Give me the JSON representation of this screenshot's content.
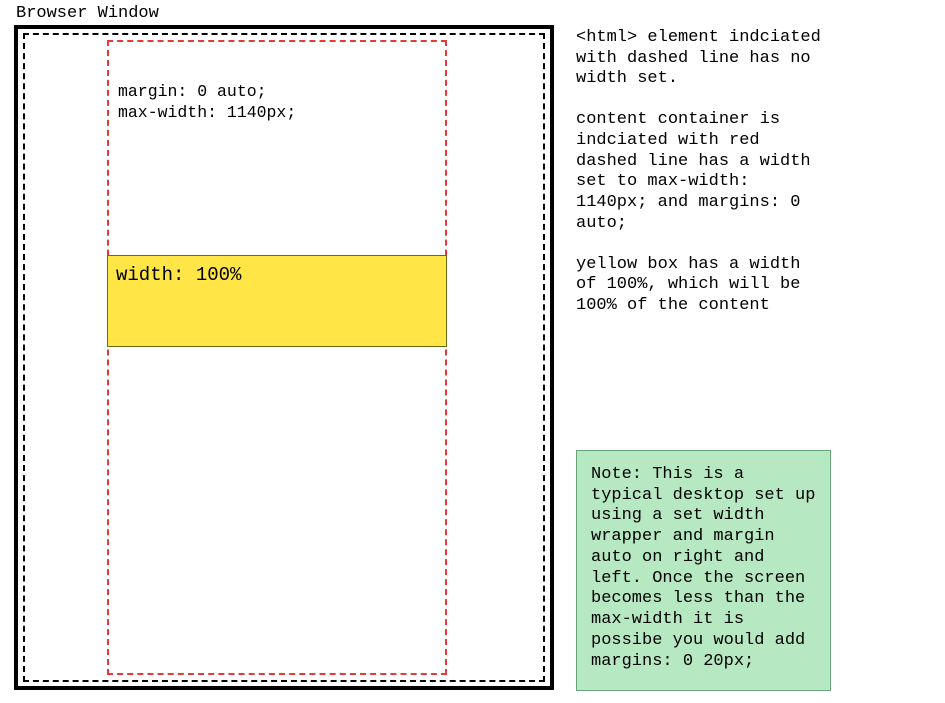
{
  "title": "Browser Window",
  "container_css_line1": "margin: 0 auto;",
  "container_css_line2": "max-width: 1140px;",
  "yellow_label": "width: 100%",
  "explain": {
    "p1": "<html> element indciated with dashed line has no width set.",
    "p2": "content container is indciated with red dashed line has a width set to max-width: 1140px; and margins: 0 auto;",
    "p3": "yellow box has a width of 100%, which will be 100% of the content"
  },
  "note": "Note: This is a typical desktop set up using a set width wrapper and margin auto on right and left. Once the screen becomes less than the max-width it is possibe you would add margins: 0 20px;"
}
